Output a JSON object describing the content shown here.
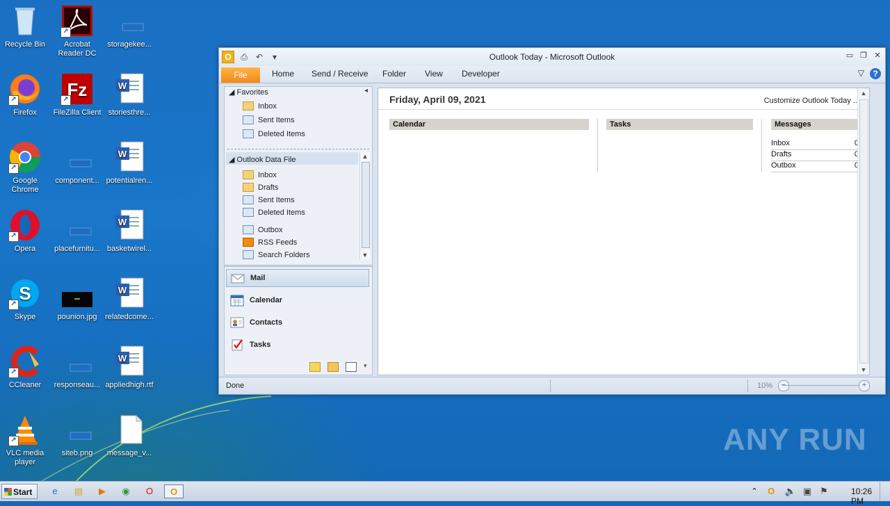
{
  "desktop": {
    "icons": [
      {
        "label": "Recycle Bin"
      },
      {
        "label": "Acrobat Reader DC"
      },
      {
        "label": "storagekee..."
      },
      {
        "label": "Firefox"
      },
      {
        "label": "FileZilla Client"
      },
      {
        "label": "storiesthre..."
      },
      {
        "label": "Google Chrome"
      },
      {
        "label": "component..."
      },
      {
        "label": "potentialren..."
      },
      {
        "label": "Opera"
      },
      {
        "label": "placefurnitu..."
      },
      {
        "label": "basketwirel..."
      },
      {
        "label": "Skype"
      },
      {
        "label": "pounion.jpg"
      },
      {
        "label": "relatedcome..."
      },
      {
        "label": "CCleaner"
      },
      {
        "label": "responseau..."
      },
      {
        "label": "appliedhigh.rtf"
      },
      {
        "label": "VLC media player"
      },
      {
        "label": "siteb.png"
      },
      {
        "label": "message_v..."
      }
    ],
    "watermark": "ANY RUN"
  },
  "window": {
    "title": "Outlook Today  -  Microsoft Outlook",
    "ribbon_tabs": [
      "File",
      "Home",
      "Send / Receive",
      "Folder",
      "View",
      "Developer"
    ],
    "help": "?"
  },
  "nav": {
    "favorites_label": "Favorites",
    "favorites": [
      "Inbox",
      "Sent Items",
      "Deleted Items"
    ],
    "datafile_label": "Outlook Data File",
    "datafile_items": [
      "Inbox",
      "Drafts",
      "Sent Items",
      "Deleted Items",
      "Outbox",
      "RSS Feeds",
      "Search Folders"
    ],
    "modules": [
      "Mail",
      "Calendar",
      "Contacts",
      "Tasks"
    ]
  },
  "content": {
    "date": "Friday, April 09, 2021",
    "customize": "Customize Outlook Today ...",
    "calendar_header": "Calendar",
    "tasks_header": "Tasks",
    "messages_header": "Messages",
    "messages": [
      {
        "name": "Inbox",
        "count": "0"
      },
      {
        "name": "Drafts",
        "count": "0"
      },
      {
        "name": "Outbox",
        "count": "0"
      }
    ]
  },
  "status": {
    "text": "Done",
    "zoom": "10%"
  },
  "taskbar": {
    "start": "Start",
    "clock": "10:26 PM"
  }
}
